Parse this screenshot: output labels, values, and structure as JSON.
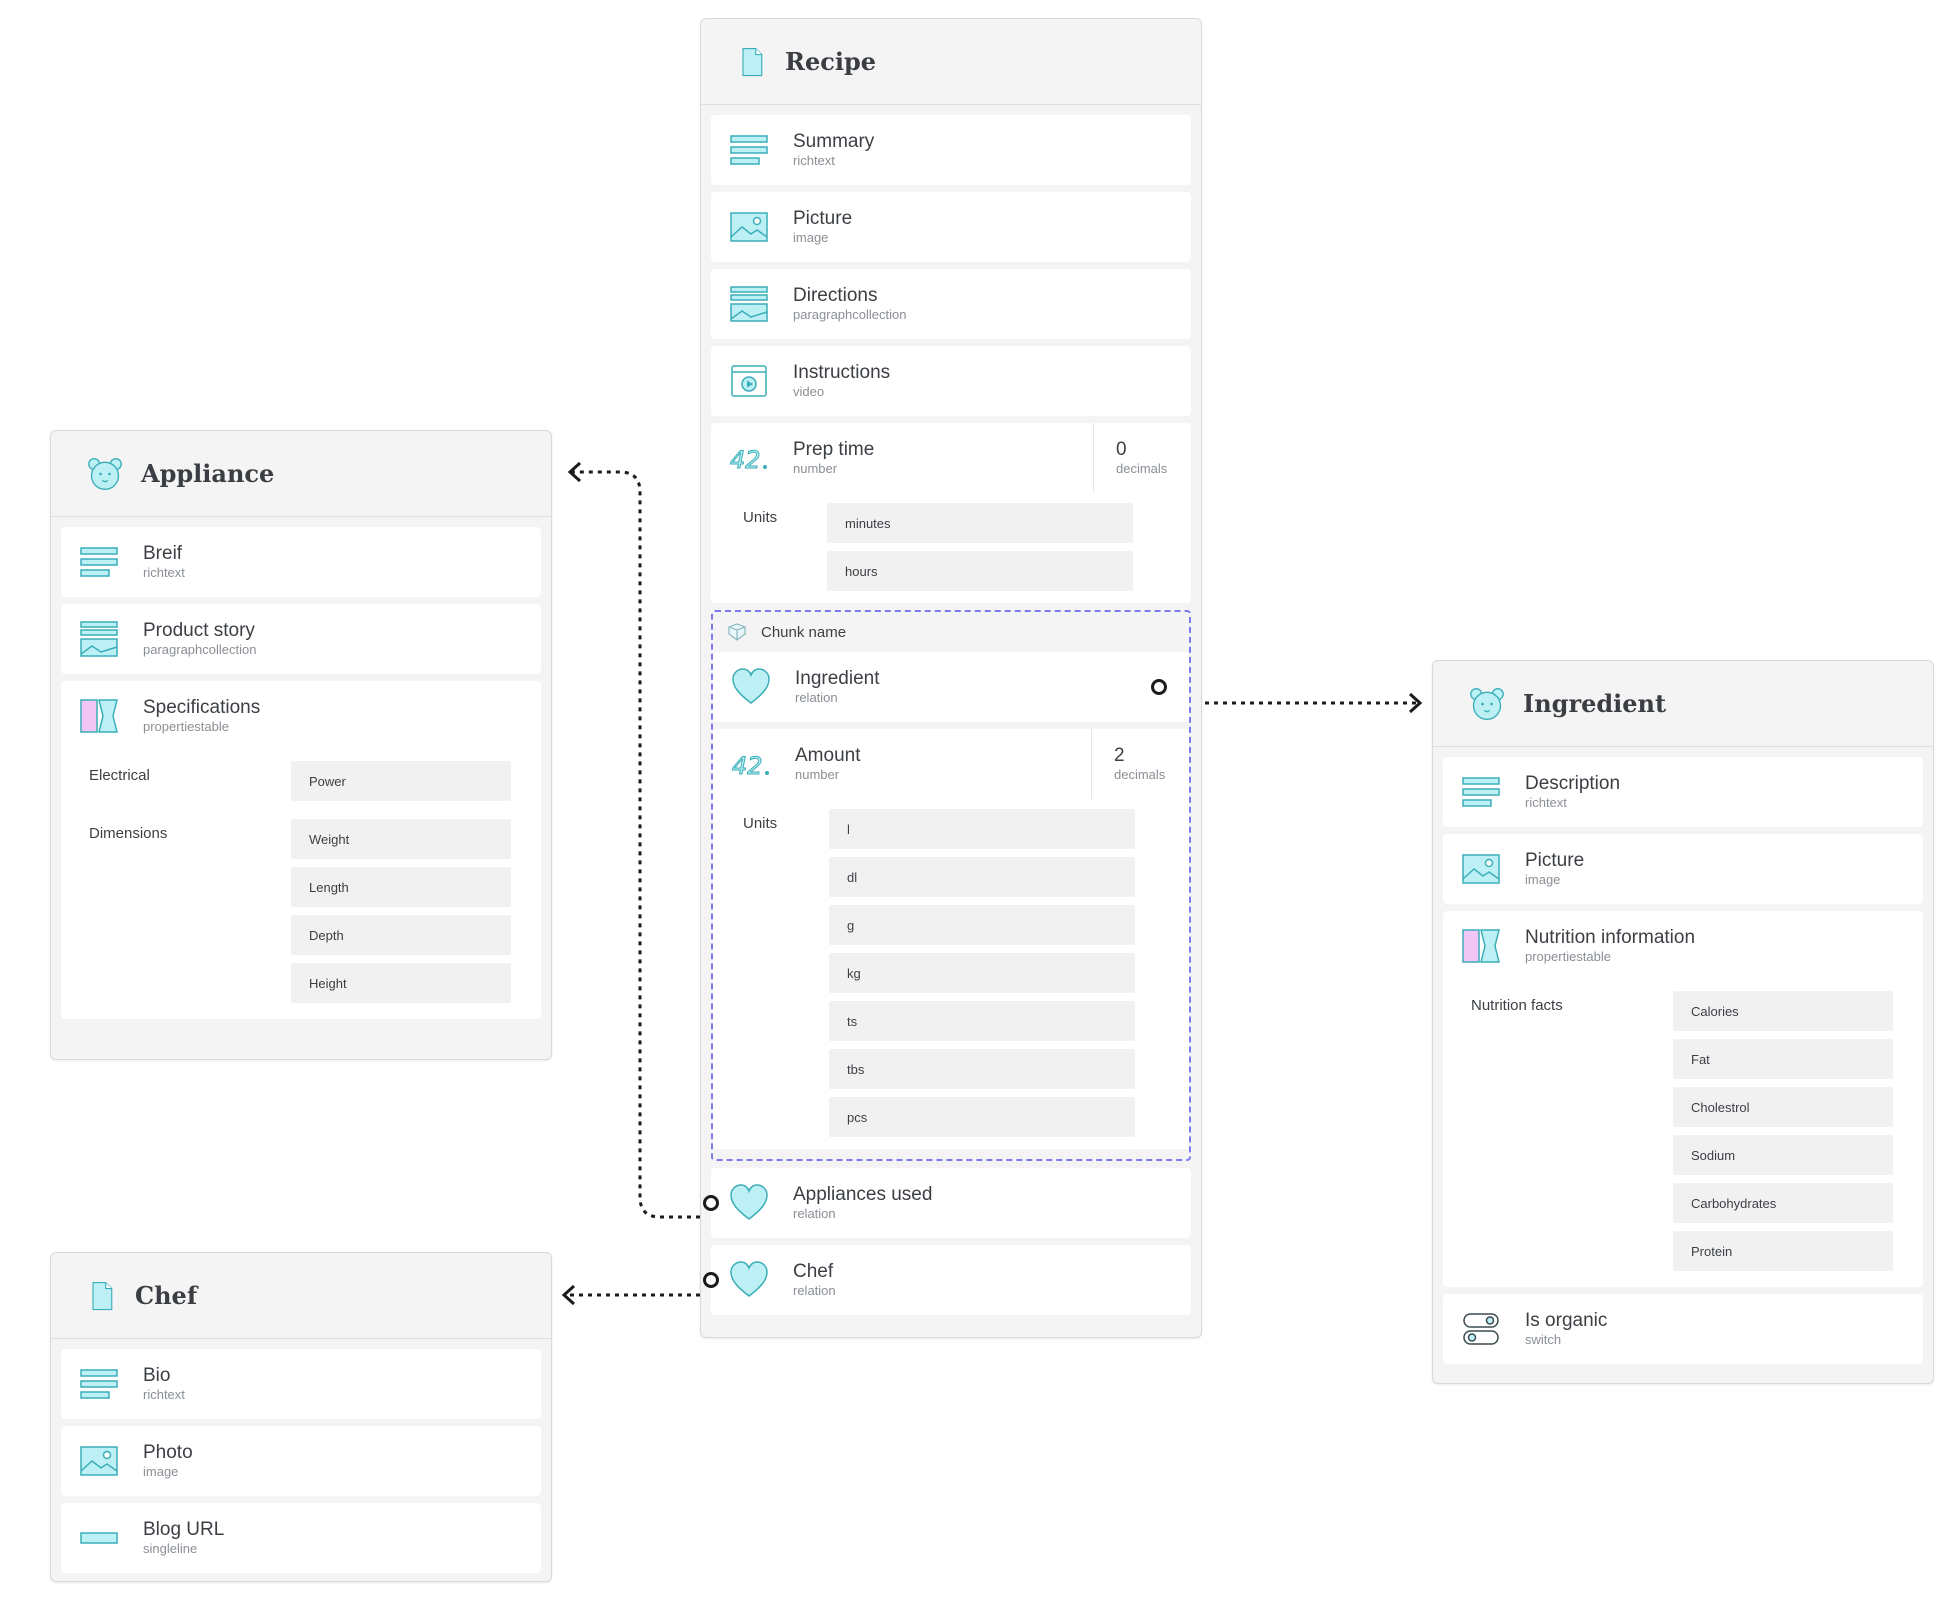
{
  "colors": {
    "icon_fill": "#bdf0f5",
    "icon_stroke": "#3aaeb8",
    "accent_pink": "#f2c6f5",
    "chunk_border": "#7b7bf0"
  },
  "recipe": {
    "title": "Recipe",
    "summary": {
      "name": "Summary",
      "type": "richtext"
    },
    "picture": {
      "name": "Picture",
      "type": "image"
    },
    "directions": {
      "name": "Directions",
      "type": "paragraphcollection"
    },
    "instructions": {
      "name": "Instructions",
      "type": "video"
    },
    "prep_time": {
      "name": "Prep time",
      "type": "number",
      "decimals": "0",
      "decimals_label": "decimals",
      "units_label": "Units",
      "units": [
        "minutes",
        "hours"
      ]
    },
    "chunk": {
      "name": "Chunk name",
      "ingredient": {
        "name": "Ingredient",
        "type": "relation"
      },
      "amount": {
        "name": "Amount",
        "type": "number",
        "decimals": "2",
        "decimals_label": "decimals",
        "units_label": "Units",
        "units": [
          "l",
          "dl",
          "g",
          "kg",
          "ts",
          "tbs",
          "pcs"
        ]
      }
    },
    "appliances_used": {
      "name": "Appliances used",
      "type": "relation"
    },
    "chef": {
      "name": "Chef",
      "type": "relation"
    }
  },
  "appliance": {
    "title": "Appliance",
    "breif": {
      "name": "Breif",
      "type": "richtext"
    },
    "product_story": {
      "name": "Product story",
      "type": "paragraphcollection"
    },
    "specifications": {
      "name": "Specifications",
      "type": "propertiestable",
      "groups": [
        {
          "label": "Electrical",
          "items": [
            "Power"
          ]
        },
        {
          "label": "Dimensions",
          "items": [
            "Weight",
            "Length",
            "Depth",
            "Height"
          ]
        }
      ]
    }
  },
  "chef_shape": {
    "title": "Chef",
    "bio": {
      "name": "Bio",
      "type": "richtext"
    },
    "photo": {
      "name": "Photo",
      "type": "image"
    },
    "blog_url": {
      "name": "Blog URL",
      "type": "singleline"
    }
  },
  "ingredient_shape": {
    "title": "Ingredient",
    "description": {
      "name": "Description",
      "type": "richtext"
    },
    "picture": {
      "name": "Picture",
      "type": "image"
    },
    "nutrition": {
      "name": "Nutrition information",
      "type": "propertiestable",
      "groups": [
        {
          "label": "Nutrition facts",
          "items": [
            "Calories",
            "Fat",
            "Cholestrol",
            "Sodium",
            "Carbohydrates",
            "Protein"
          ]
        }
      ]
    },
    "is_organic": {
      "name": "Is organic",
      "type": "switch"
    }
  }
}
